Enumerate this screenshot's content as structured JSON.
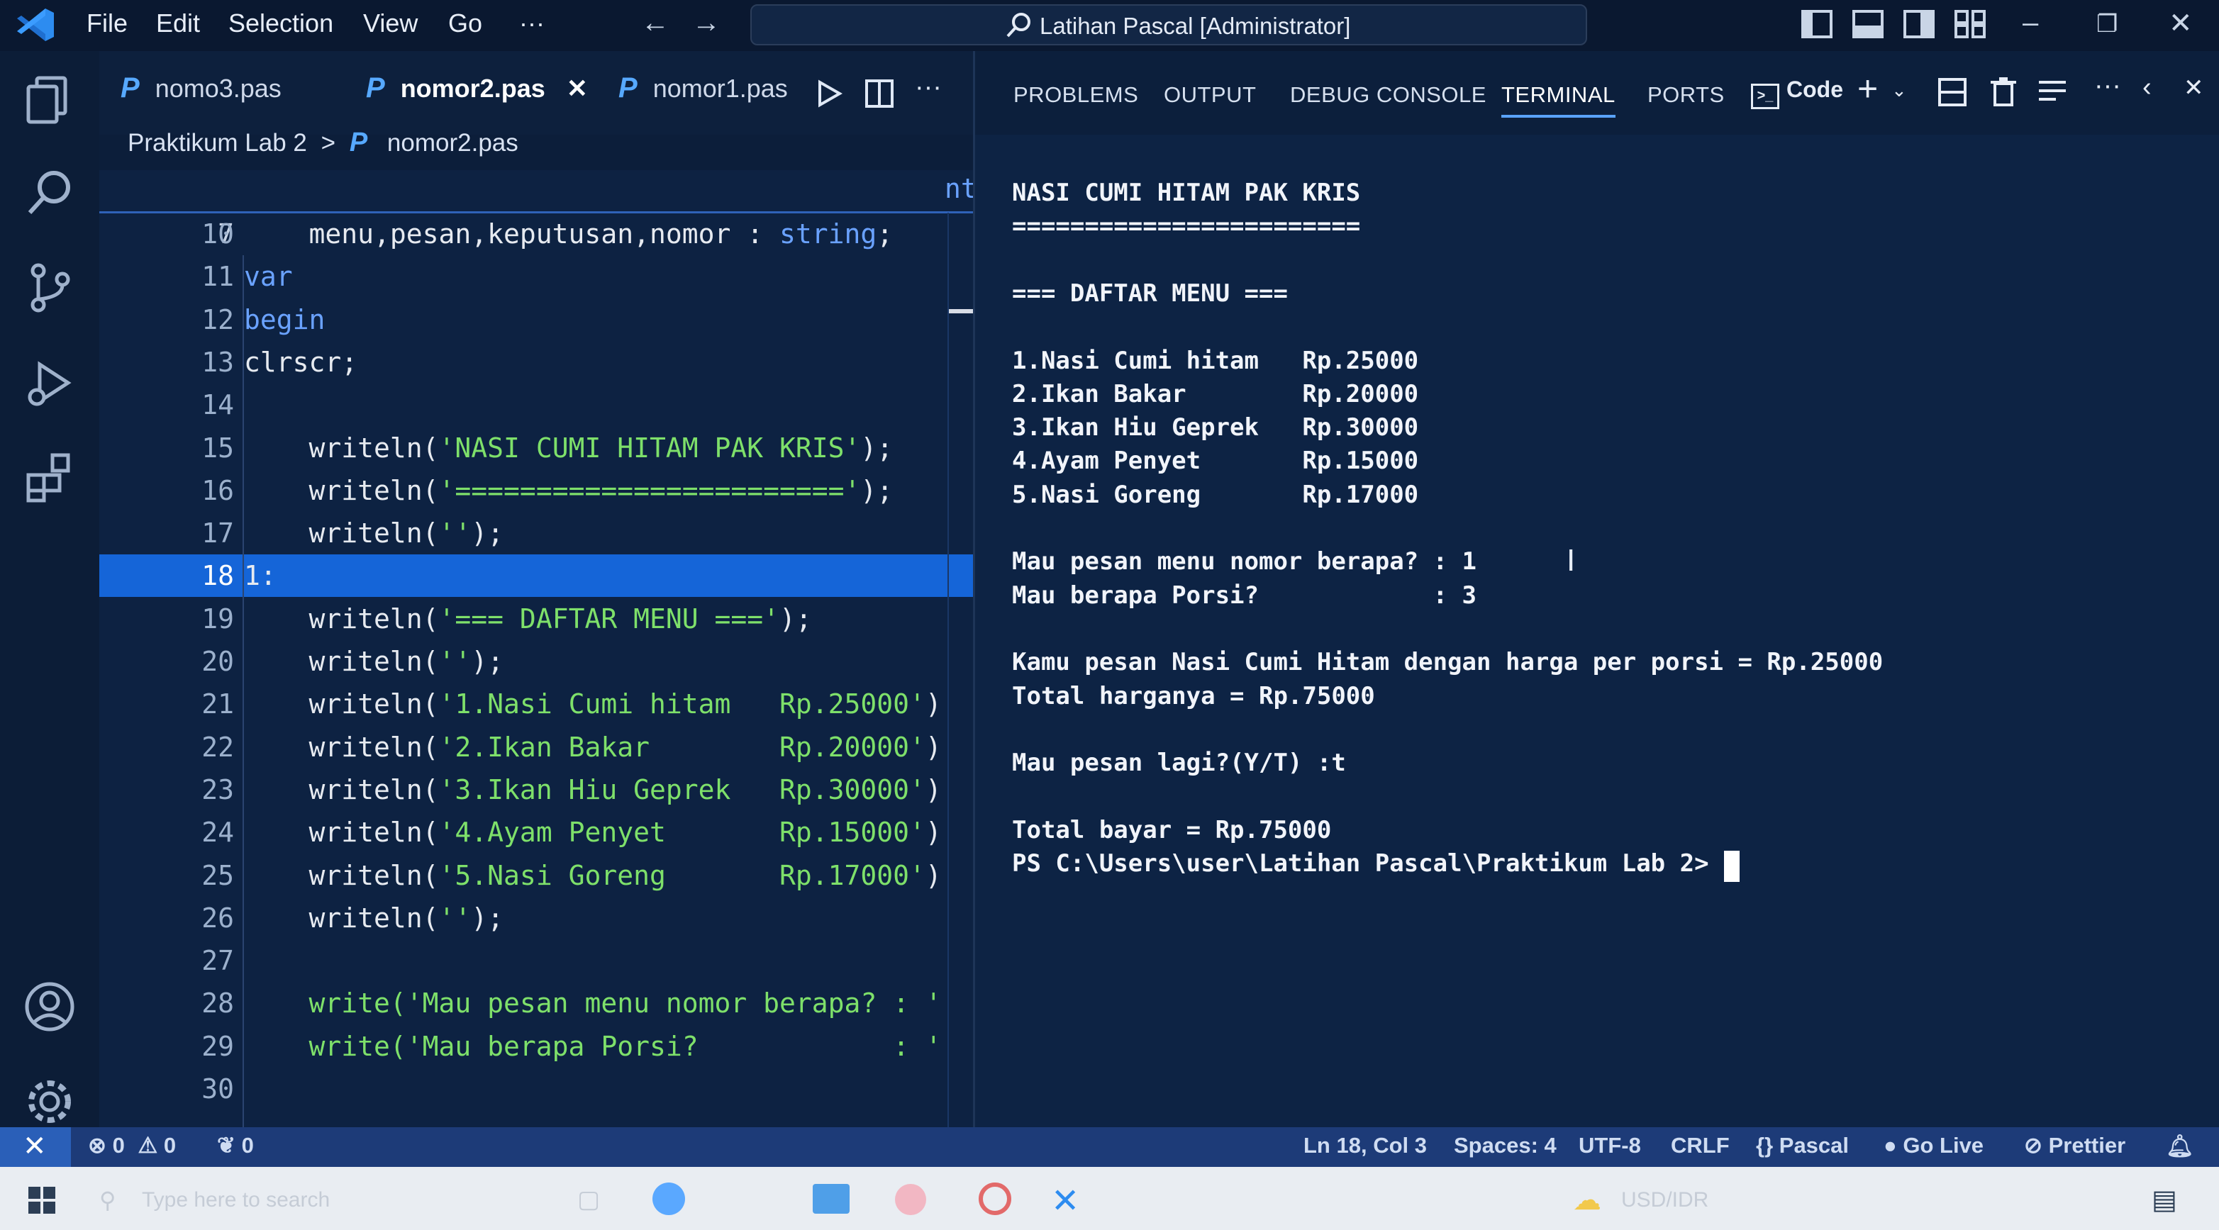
{
  "titlebar": {
    "menus": [
      "File",
      "Edit",
      "Selection",
      "View",
      "Go",
      "···"
    ],
    "title": "Latihan Pascal [Administrator]"
  },
  "editor": {
    "tabs": [
      {
        "label": "nomo3.pas",
        "icon": "P",
        "active": false
      },
      {
        "label": "nomor2.pas",
        "icon": "P",
        "active": true,
        "close": "✕"
      },
      {
        "label": "nomor1.pas",
        "icon": "P",
        "active": false
      }
    ],
    "breadcrumb": {
      "folder": "Praktikum Lab 2",
      "sep": ">",
      "icon": "P",
      "file": "nomor2.pas"
    },
    "sticky_line": {
      "num": "7",
      "text": "var"
    },
    "right_fragment": "nt",
    "lines": [
      {
        "num": "10",
        "parts": [
          {
            "t": "    menu,pesan,keputusan,nomor : ",
            "c": "fn"
          },
          {
            "t": "string",
            "c": "kw"
          },
          {
            "t": ";",
            "c": "fn"
          }
        ]
      },
      {
        "num": "11",
        "parts": []
      },
      {
        "num": "12",
        "parts": [
          {
            "t": "begin",
            "c": "kw"
          }
        ]
      },
      {
        "num": "13",
        "parts": [
          {
            "t": "clrscr;",
            "c": "fn"
          }
        ]
      },
      {
        "num": "14",
        "parts": []
      },
      {
        "num": "15",
        "parts": [
          {
            "t": "    writeln(",
            "c": "fn"
          },
          {
            "t": "'NASI CUMI HITAM PAK KRIS'",
            "c": "str"
          },
          {
            "t": ");",
            "c": "fn"
          }
        ]
      },
      {
        "num": "16",
        "parts": [
          {
            "t": "    writeln(",
            "c": "fn"
          },
          {
            "t": "'========================'",
            "c": "str"
          },
          {
            "t": ");",
            "c": "fn"
          }
        ]
      },
      {
        "num": "17",
        "parts": [
          {
            "t": "    writeln(",
            "c": "fn"
          },
          {
            "t": "''",
            "c": "str"
          },
          {
            "t": ");",
            "c": "fn"
          }
        ]
      },
      {
        "num": "18",
        "current": true,
        "parts": [
          {
            "t": "1:",
            "c": "fn"
          }
        ]
      },
      {
        "num": "19",
        "parts": [
          {
            "t": "    writeln(",
            "c": "fn"
          },
          {
            "t": "'=== DAFTAR MENU ==='",
            "c": "str"
          },
          {
            "t": ");",
            "c": "fn"
          }
        ]
      },
      {
        "num": "20",
        "parts": [
          {
            "t": "    writeln(",
            "c": "fn"
          },
          {
            "t": "''",
            "c": "str"
          },
          {
            "t": ");",
            "c": "fn"
          }
        ]
      },
      {
        "num": "21",
        "parts": [
          {
            "t": "    writeln(",
            "c": "fn"
          },
          {
            "t": "'1.Nasi Cumi hitam   Rp.25000'",
            "c": "str"
          },
          {
            "t": ")",
            "c": "fn"
          }
        ]
      },
      {
        "num": "22",
        "parts": [
          {
            "t": "    writeln(",
            "c": "fn"
          },
          {
            "t": "'2.Ikan Bakar        Rp.20000'",
            "c": "str"
          },
          {
            "t": ")",
            "c": "fn"
          }
        ]
      },
      {
        "num": "23",
        "parts": [
          {
            "t": "    writeln(",
            "c": "fn"
          },
          {
            "t": "'3.Ikan Hiu Geprek   Rp.30000'",
            "c": "str"
          },
          {
            "t": ")",
            "c": "fn"
          }
        ]
      },
      {
        "num": "24",
        "parts": [
          {
            "t": "    writeln(",
            "c": "fn"
          },
          {
            "t": "'4.Ayam Penyet       Rp.15000'",
            "c": "str"
          },
          {
            "t": ")",
            "c": "fn"
          }
        ]
      },
      {
        "num": "25",
        "parts": [
          {
            "t": "    writeln(",
            "c": "fn"
          },
          {
            "t": "'5.Nasi Goreng       Rp.17000'",
            "c": "str"
          },
          {
            "t": ")",
            "c": "fn"
          }
        ]
      },
      {
        "num": "26",
        "parts": [
          {
            "t": "    writeln(",
            "c": "fn"
          },
          {
            "t": "''",
            "c": "str"
          },
          {
            "t": ");",
            "c": "fn"
          }
        ]
      },
      {
        "num": "27",
        "parts": []
      },
      {
        "num": "28",
        "parts": [
          {
            "t": "    write(",
            "c": "str"
          },
          {
            "t": "'Mau pesan menu nomor berapa? : '",
            "c": "str"
          }
        ]
      },
      {
        "num": "29",
        "parts": [
          {
            "t": "    write(",
            "c": "str"
          },
          {
            "t": "'Mau berapa Porsi?            : '",
            "c": "str"
          }
        ]
      },
      {
        "num": "30",
        "parts": []
      }
    ]
  },
  "panel": {
    "tabs": [
      "PROBLEMS",
      "OUTPUT",
      "DEBUG CONSOLE",
      "TERMINAL",
      "PORTS"
    ],
    "active_tab": "TERMINAL",
    "terminal_profile": "Code"
  },
  "terminal": {
    "lines": [
      "NASI CUMI HITAM PAK KRIS",
      "========================",
      "",
      "=== DAFTAR MENU ===",
      "",
      "1.Nasi Cumi hitam   Rp.25000",
      "2.Ikan Bakar        Rp.20000",
      "3.Ikan Hiu Geprek   Rp.30000",
      "4.Ayam Penyet       Rp.15000",
      "5.Nasi Goreng       Rp.17000",
      "",
      "Mau pesan menu nomor berapa? : 1",
      "Mau berapa Porsi?            : 3",
      "",
      "Kamu pesan Nasi Cumi Hitam dengan harga per porsi = Rp.25000",
      "Total harganya = Rp.75000",
      "",
      "Mau pesan lagi?(Y/T) :t",
      "",
      "Total bayar = Rp.75000",
      "PS C:\\Users\\user\\Latihan Pascal\\Praktikum Lab 2> "
    ]
  },
  "statusbar": {
    "errors": "0",
    "warnings": "0",
    "ports": "0",
    "position": "Ln 18, Col 3",
    "spaces": "Spaces: 4",
    "encoding": "UTF-8",
    "eol": "CRLF",
    "language": "Pascal",
    "golive": "Go Live",
    "prettier": "Prettier"
  },
  "taskbar": {
    "search_placeholder": "Type here to search",
    "currency": "USD/IDR"
  },
  "colors": {
    "accent": "#1565d8",
    "string": "#7ee06a",
    "keyword": "#6aa2ff",
    "statusbar": "#1d3b78"
  }
}
